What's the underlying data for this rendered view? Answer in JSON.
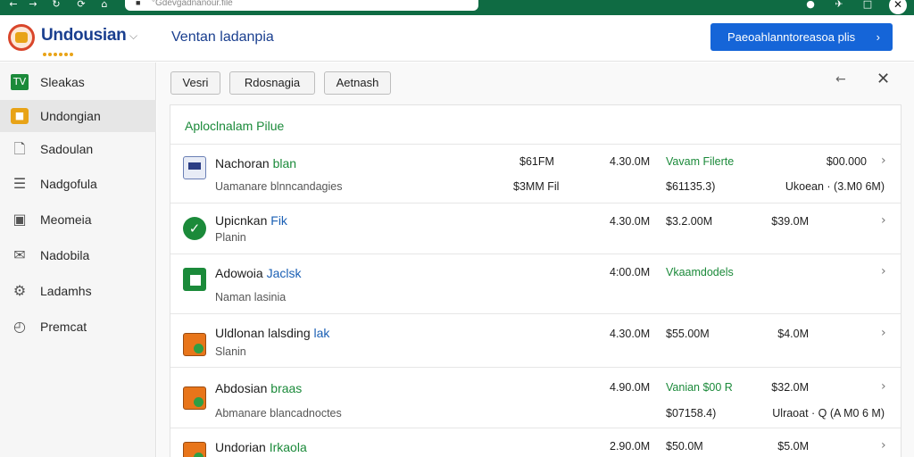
{
  "browser": {
    "url": "°Gdevgadnanöur.file"
  },
  "header": {
    "app_name": "Undousian",
    "title": "Ventan ladanpia",
    "primary_button": "Paeoahlanntoreasoa plis"
  },
  "sidebar": {
    "items": [
      {
        "label": "Sleakas",
        "icon": "spreadsheet-icon"
      },
      {
        "label": "Undongian",
        "icon": "folder-icon"
      },
      {
        "label": "Sadoulan",
        "icon": "document-icon"
      },
      {
        "label": "Nadgofula",
        "icon": "list-icon"
      },
      {
        "label": "Meomeia",
        "icon": "image-icon"
      },
      {
        "label": "Nadobila",
        "icon": "send-icon"
      },
      {
        "label": "Ladamhs",
        "icon": "gear-icon"
      },
      {
        "label": "Premcat",
        "icon": "clock-icon"
      }
    ]
  },
  "toolbar": {
    "tabs": [
      "Vesri",
      "Rdosnagia",
      "Aetnash"
    ]
  },
  "panel": {
    "title": "Aploclnalam Pilue"
  },
  "rows": [
    {
      "name": "Nachoran ",
      "name_accent": "blan",
      "sub": "Uamanare blnncandagies",
      "c1": "$61FM",
      "c1b": "$3MM Fil",
      "c2": "4.30.0M",
      "c3": "Vavam Filerte",
      "c3b": "$61135.3)",
      "c4": "$00.000",
      "c4b": "Ukoean · (3.M0 6M)"
    },
    {
      "name": "Upicnkan ",
      "name_accent": "Fik",
      "sub": "Planin",
      "c2": "4.30.0M",
      "c3": "$3.2.00M",
      "c4": "$39.0M"
    },
    {
      "name": "Adowoia ",
      "name_accent": "Jaclsk",
      "sub": "Naman lasinia",
      "c2": "4:00.0M",
      "c3": "Vkaamdodels"
    },
    {
      "name": "Uldlonan lalsding ",
      "name_accent": "lak",
      "sub": "Slanin",
      "c2": "4.30.0M",
      "c3": "$55.00M",
      "c4": "$4.0M"
    },
    {
      "name": "Abdosian ",
      "name_accent": "braas",
      "sub": "Abmanare blancadnoctes",
      "c2": "4.90.0M",
      "c3": "Vanian $00 R",
      "c3b": "$07158.4)",
      "c4": "$32.0M",
      "c4b": "Ulraoat · Q (A M0 6 M)"
    },
    {
      "name": "Undorian ",
      "name_accent": "Irkaola",
      "c2": "2.90.0M",
      "c3": "$50.0M",
      "c4": "$5.0M"
    }
  ]
}
